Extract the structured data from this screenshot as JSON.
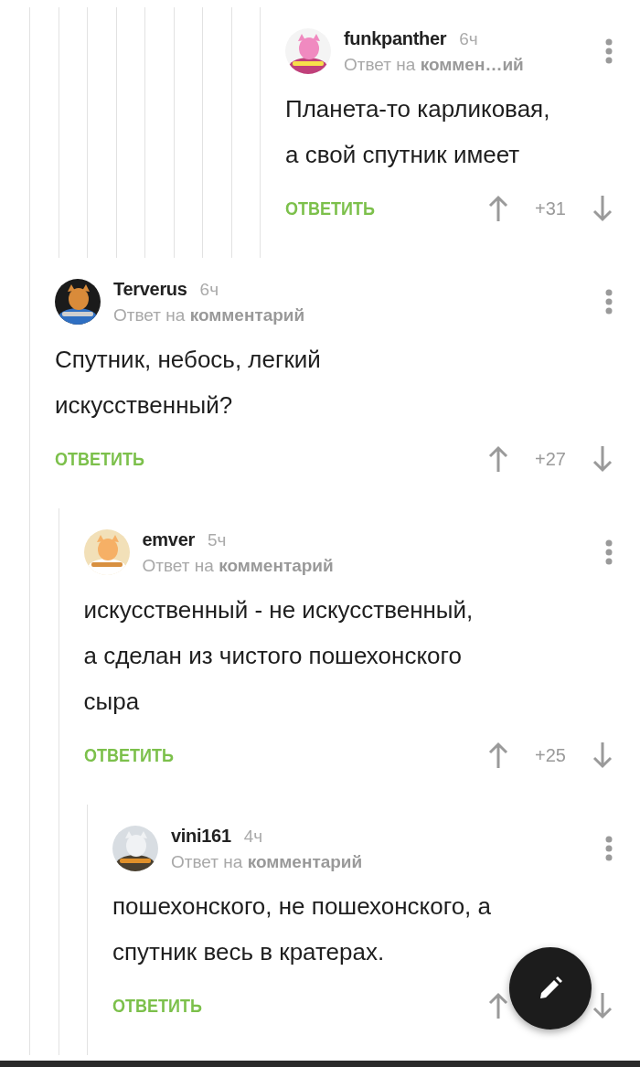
{
  "comments": [
    {
      "kind": "deep_reply",
      "author": "funkpanther",
      "time": "6ч",
      "reply_to": "Ответ на **коммен…ий**",
      "text": "Планета-то карликовая,\nа свой спутник имеет",
      "reply_button": "ОТВЕТИТЬ",
      "rating": "+31"
    },
    {
      "kind": "reply",
      "author": "Terverus",
      "time": "6ч",
      "reply_to": "Ответ на **комментарий**",
      "text": "Спутник, небось, легкий\nискусственный?",
      "reply_button": "ОТВЕТИТЬ",
      "rating": "+27",
      "children": [
        {
          "kind": "reply",
          "author": "emver",
          "time": "5ч",
          "reply_to": "Ответ на **комментарий**",
          "text": "искусственный - не искусственный,\nа сделан из чистого пошехонского\nсыра",
          "reply_button": "ОТВЕТИТЬ",
          "rating": "+25",
          "children": [
            {
              "kind": "reply",
              "author": "vini161",
              "time": "4ч",
              "reply_to": "Ответ на **комментарий**",
              "text": "пошехонского, не пошехонского, а\nспутник весь в кратерах.",
              "reply_button": "ОТВЕТИТЬ"
            }
          ]
        }
      ]
    }
  ]
}
